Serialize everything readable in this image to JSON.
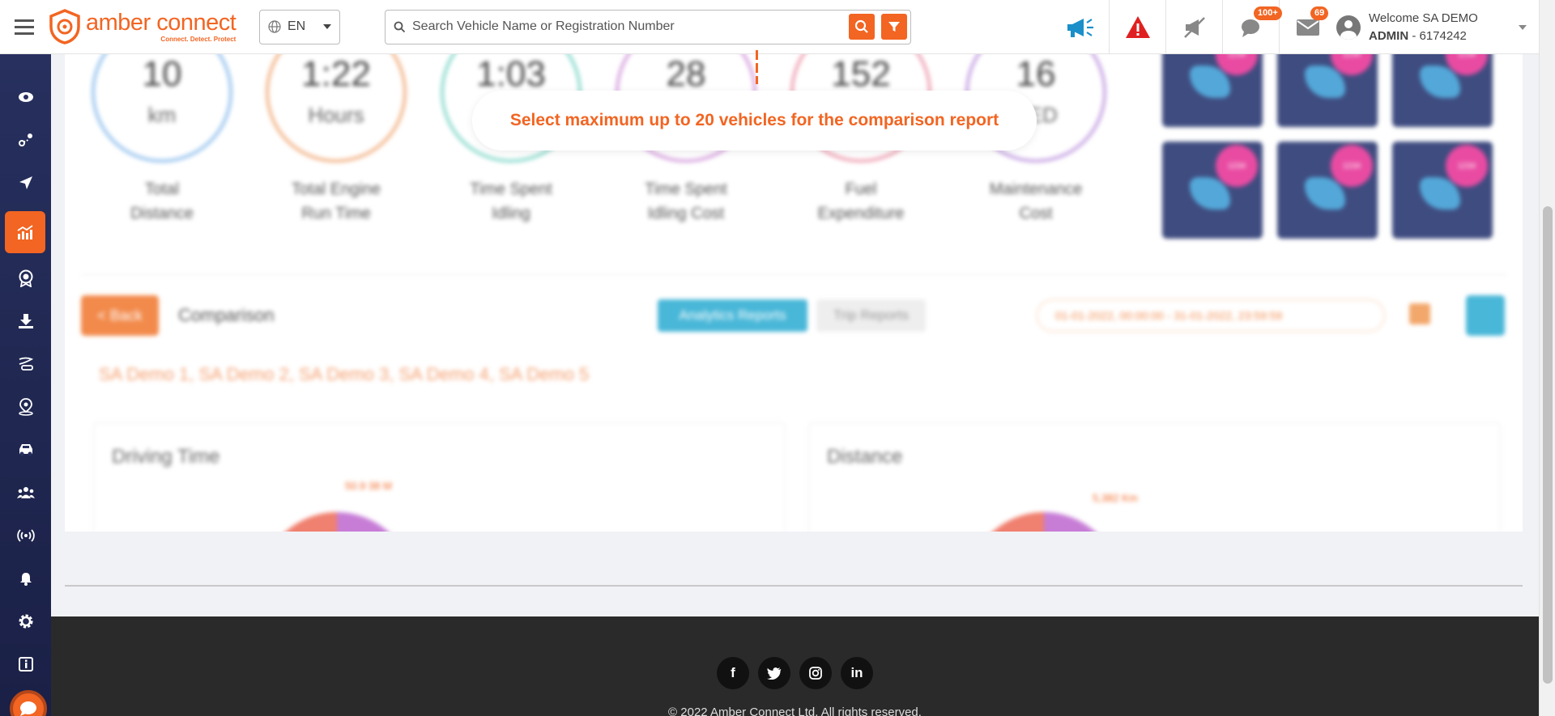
{
  "header": {
    "brand_name": "amber connect",
    "brand_tagline": "Connect. Detect. Protect",
    "language": "EN",
    "search_placeholder": "Search Vehicle Name or Registration Number",
    "notifications_badge": "100+",
    "messages_badge": "69",
    "welcome_text": "Welcome SA DEMO",
    "role": "ADMIN",
    "account_suffix": " - 6174242"
  },
  "toast": {
    "message": "Select maximum up to 20 vehicles for the comparison report"
  },
  "stats": [
    {
      "value": "10",
      "unit": "km",
      "label_line1": "Total",
      "label_line2": "Distance",
      "color": "#9cc6ef"
    },
    {
      "value": "1:22",
      "unit": "Hours",
      "label_line1": "Total Engine",
      "label_line2": "Run Time",
      "color": "#f3b78d"
    },
    {
      "value": "1:03",
      "unit": "",
      "label_line1": "Time Spent",
      "label_line2": "Idling",
      "color": "#8fdccf"
    },
    {
      "value": "28",
      "unit": "",
      "label_line1": "Time Spent",
      "label_line2": "Idling Cost",
      "color": "#d9a6e0"
    },
    {
      "value": "152",
      "unit": "",
      "label_line1": "Fuel",
      "label_line2": "Expenditure",
      "color": "#f0a6b8"
    },
    {
      "value": "16",
      "unit": "AED",
      "label_line1": "Maintenance",
      "label_line2": "Cost",
      "color": "#c8a6e4"
    }
  ],
  "tile_badge": "1234",
  "comparison": {
    "back_label": "< Back",
    "title": "Comparison",
    "tab_active": "Analytics Reports",
    "tab_inactive": "Trip Reports",
    "date_range": "01-01-2022, 00:00:00 - 31-01-2022, 23:59:59",
    "vehicles": "SA Demo 1, SA Demo 2, SA Demo 3, SA Demo 4, SA Demo 5"
  },
  "cards": [
    {
      "title": "Driving Time",
      "note": "50.9 38 M"
    },
    {
      "title": "Distance",
      "note": "5,382 Km"
    }
  ],
  "footer": {
    "social": [
      "f",
      "t",
      "ig",
      "in"
    ],
    "copyright": "© 2022 Amber Connect Ltd. All rights reserved."
  },
  "colors": {
    "accent": "#f26522",
    "sidebar": "#27305e",
    "alert": "#e02020",
    "megaphone": "#1a8fc9"
  }
}
